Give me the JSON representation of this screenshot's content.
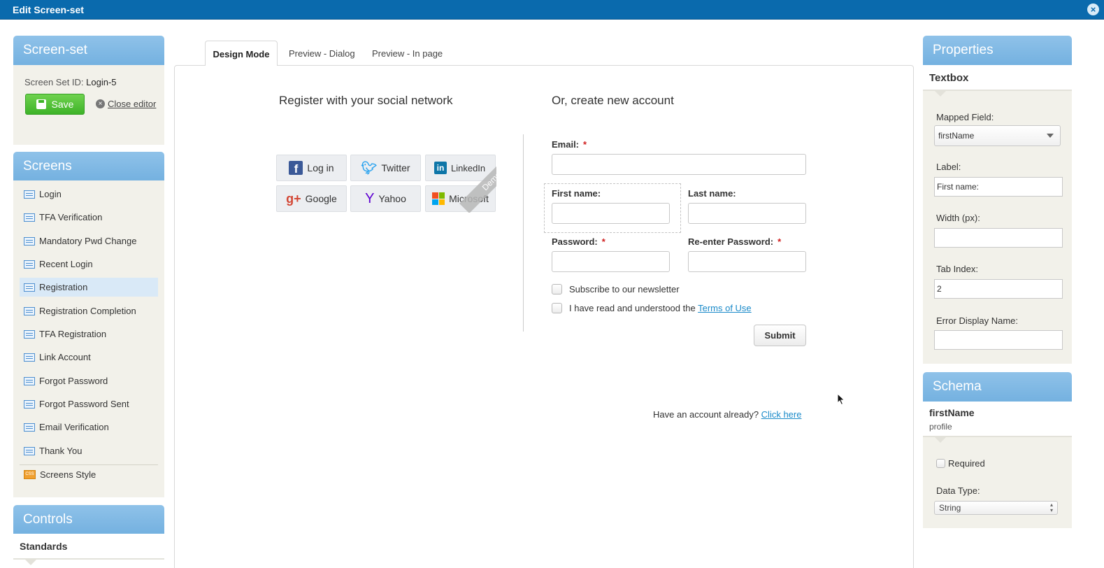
{
  "window": {
    "title": "Edit Screen-set",
    "close_icon": "close-icon"
  },
  "screenset": {
    "heading": "Screen-set",
    "id_label": "Screen Set ID:",
    "id_value": "Login-5",
    "save_label": "Save",
    "close_editor_label": "Close editor"
  },
  "screens": {
    "heading": "Screens",
    "items": [
      {
        "label": "Login"
      },
      {
        "label": "TFA Verification"
      },
      {
        "label": "Mandatory Pwd Change"
      },
      {
        "label": "Recent Login"
      },
      {
        "label": "Registration",
        "selected": true
      },
      {
        "label": "Registration Completion"
      },
      {
        "label": "TFA Registration"
      },
      {
        "label": "Link Account"
      },
      {
        "label": "Forgot Password"
      },
      {
        "label": "Forgot Password Sent"
      },
      {
        "label": "Email Verification"
      },
      {
        "label": "Thank You"
      }
    ],
    "style_item": "Screens Style",
    "style_icon_text": "CSS"
  },
  "controls": {
    "heading": "Controls",
    "sub": "Standards"
  },
  "tabs": [
    {
      "label": "Design Mode",
      "active": true
    },
    {
      "label": "Preview - Dialog"
    },
    {
      "label": "Preview - In page"
    }
  ],
  "form": {
    "social_title": "Register with your social network",
    "create_title": "Or, create new account",
    "social_buttons": [
      {
        "label": "Log in",
        "icon": "facebook-icon"
      },
      {
        "label": "Twitter",
        "icon": "twitter-icon"
      },
      {
        "label": "LinkedIn",
        "icon": "linkedin-icon"
      },
      {
        "label": "Google",
        "icon": "google-plus-icon"
      },
      {
        "label": "Yahoo",
        "icon": "yahoo-icon"
      },
      {
        "label": "Microsoft",
        "icon": "microsoft-icon"
      }
    ],
    "demo_ribbon": "Demo",
    "email_label": "Email:",
    "first_name_label": "First name:",
    "last_name_label": "Last name:",
    "password_label": "Password:",
    "reenter_label": "Re-enter Password:",
    "required_mark": "*",
    "newsletter_label": "Subscribe to our newsletter",
    "terms_prefix": "I have read and understood the",
    "terms_link": "Terms of Use",
    "submit_label": "Submit",
    "have_account": "Have an account already?",
    "click_here": "Click here"
  },
  "properties": {
    "heading": "Properties",
    "sub": "Textbox",
    "mapped_field_label": "Mapped Field:",
    "mapped_field_value": "firstName",
    "label_label": "Label:",
    "label_value": "First name:",
    "width_label": "Width (px):",
    "width_value": "",
    "tab_index_label": "Tab Index:",
    "tab_index_value": "2",
    "error_name_label": "Error Display Name:",
    "error_name_value": ""
  },
  "schema": {
    "heading": "Schema",
    "field": "firstName",
    "group": "profile",
    "required_label": "Required",
    "data_type_label": "Data Type:",
    "data_type_value": "String"
  }
}
